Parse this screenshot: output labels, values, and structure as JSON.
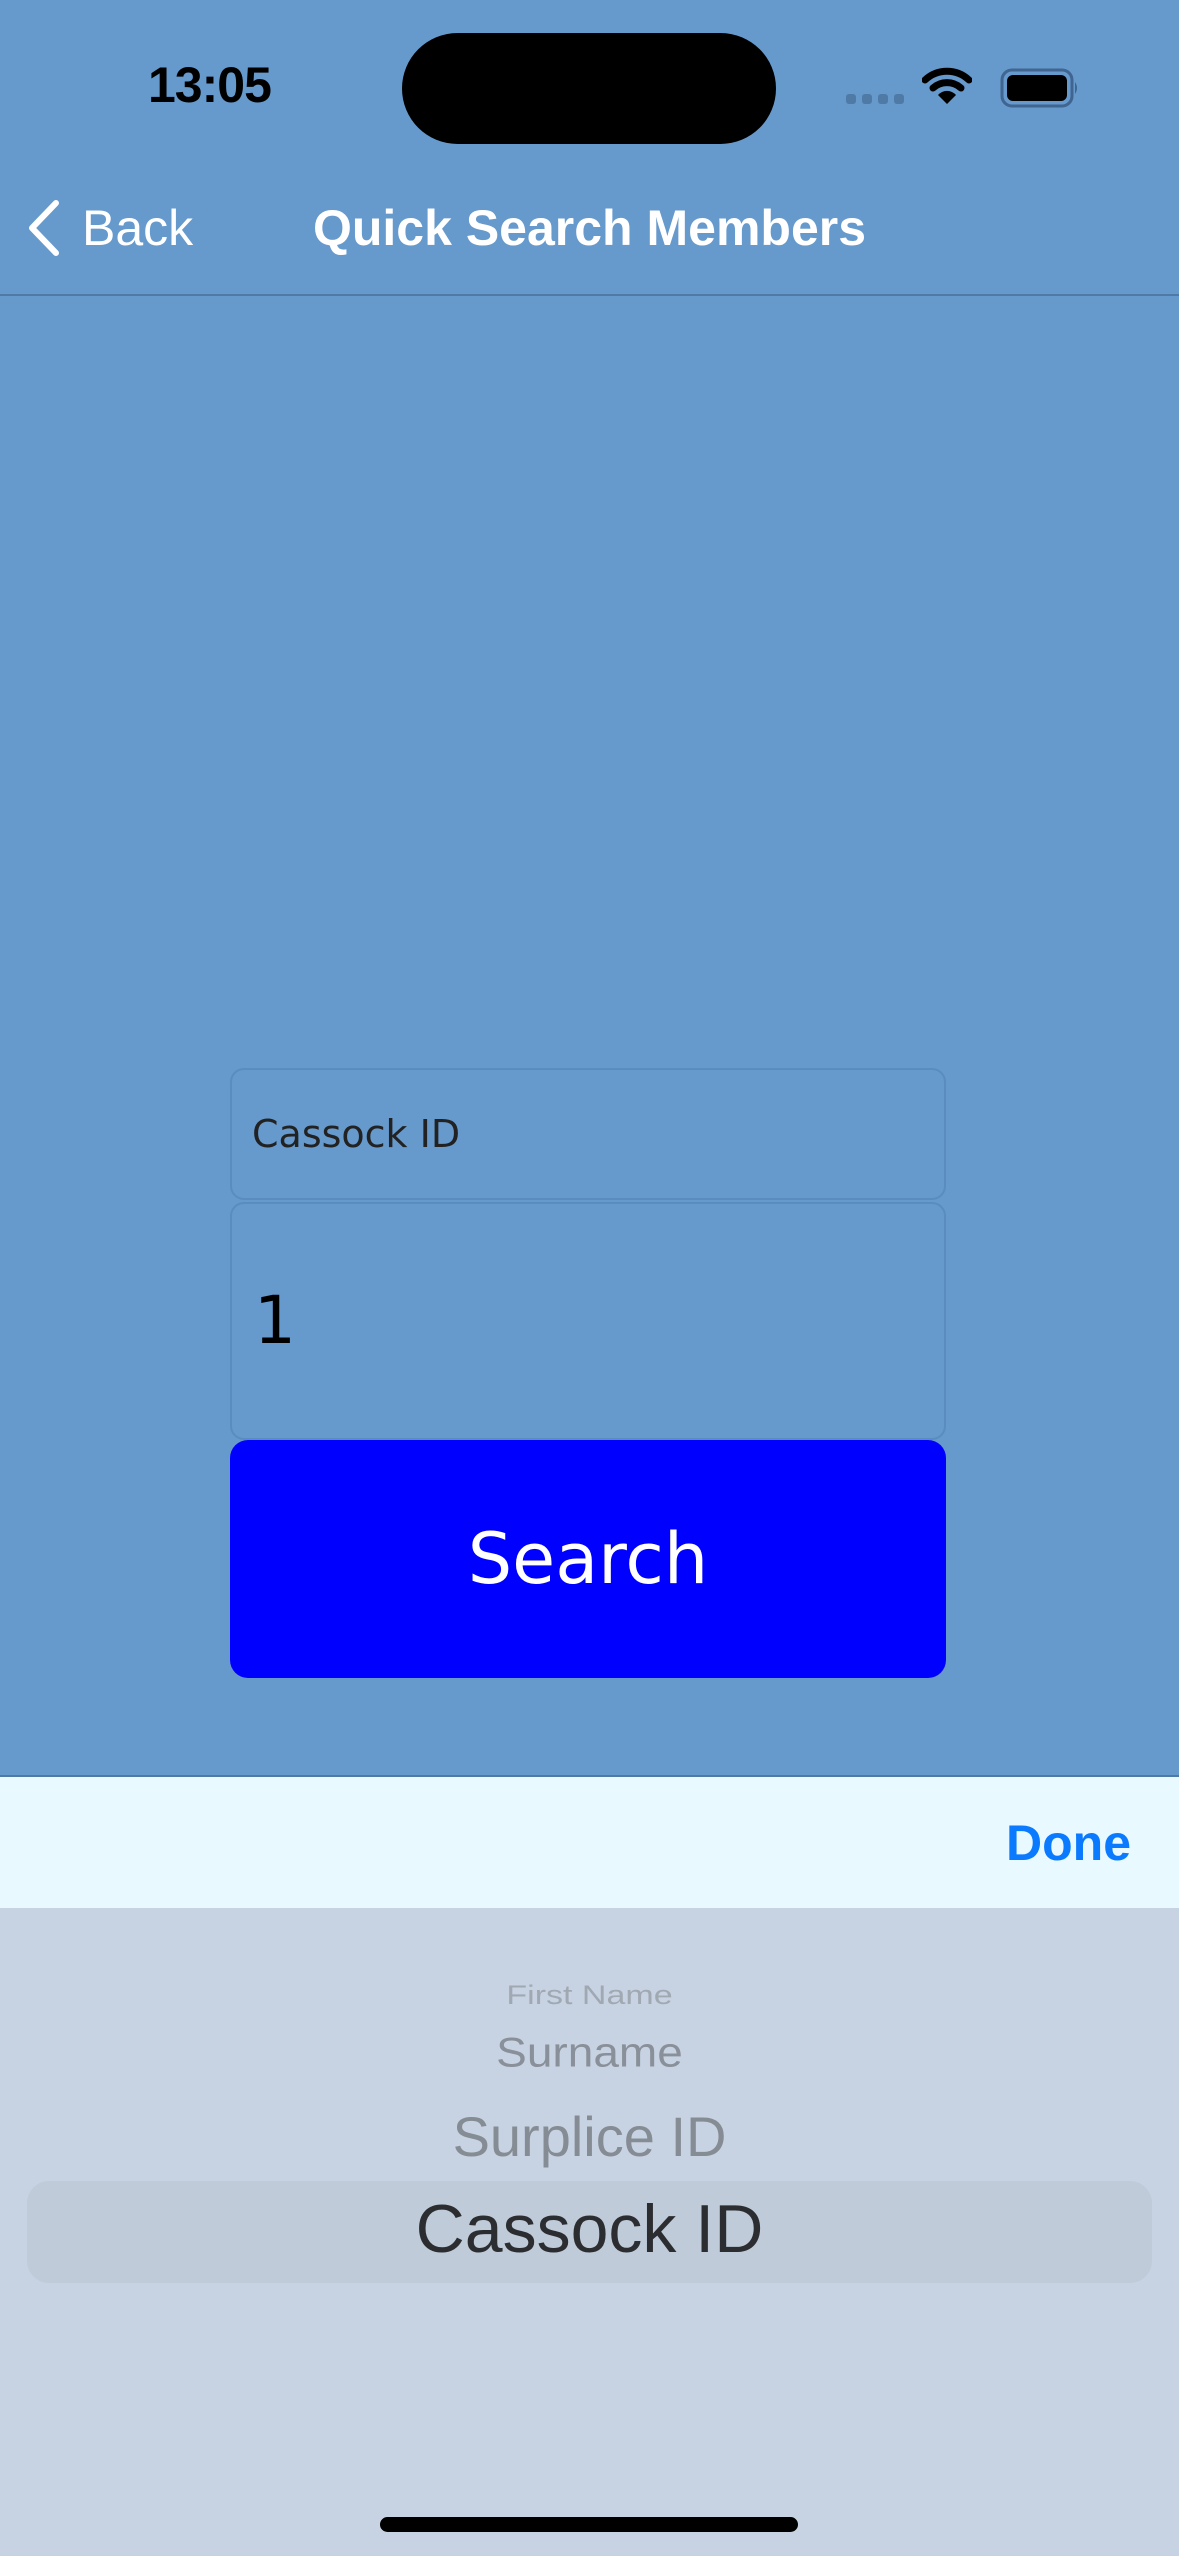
{
  "status_bar": {
    "time": "13:05",
    "icons": [
      "cellular-signal-icon",
      "wifi-icon",
      "battery-icon"
    ]
  },
  "nav": {
    "back_label": "Back",
    "title": "Quick Search Members"
  },
  "form": {
    "search_type_value": "Cassock ID",
    "search_value": "1",
    "search_button_label": "Search"
  },
  "picker_toolbar": {
    "done_label": "Done"
  },
  "picker": {
    "options": [
      "First Name",
      "Surname",
      "Surplice ID",
      "Cassock ID"
    ],
    "selected": "Cassock ID"
  },
  "colors": {
    "background": "#6699cc",
    "search_button": "#0000ff",
    "done_accent": "#0a7aff",
    "toolbar_bg": "#e8f9ff",
    "picker_bg": "#c7d3e3"
  }
}
